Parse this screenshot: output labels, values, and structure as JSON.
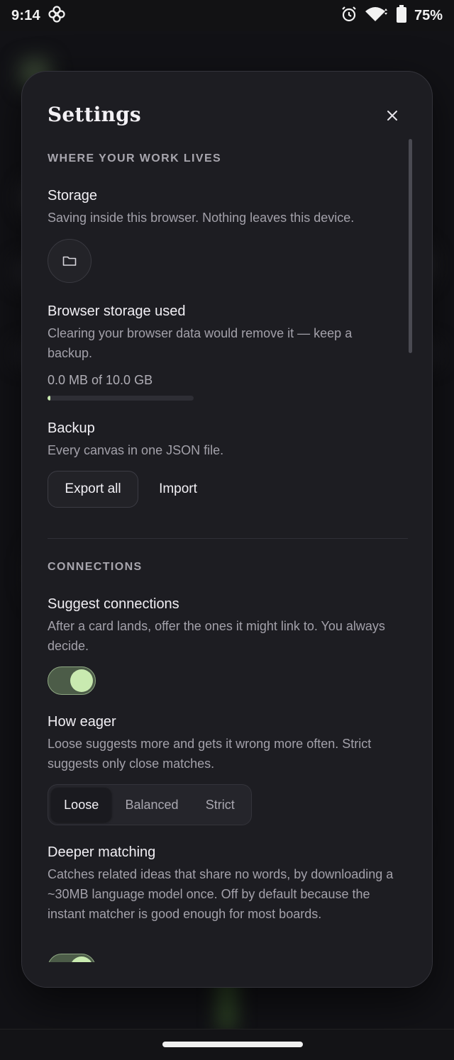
{
  "status_bar": {
    "time": "9:14",
    "battery_pct": "75%"
  },
  "modal": {
    "title": "Settings",
    "sections": {
      "work": {
        "label": "WHERE YOUR WORK LIVES",
        "storage_title": "Storage",
        "storage_desc": "Saving inside this browser. Nothing leaves this device.",
        "used_title": "Browser storage used",
        "used_desc": "Clearing your browser data would remove it — keep a backup.",
        "usage_text": "0.0 MB of 10.0 GB",
        "usage_fraction": 0.0,
        "backup_title": "Backup",
        "backup_desc": "Every canvas in one JSON file.",
        "export_label": "Export all",
        "import_label": "Import"
      },
      "connections": {
        "label": "CONNECTIONS",
        "suggest_title": "Suggest connections",
        "suggest_desc": "After a card lands, offer the ones it might link to. You always decide.",
        "suggest_on": true,
        "eager_title": "How eager",
        "eager_desc": "Loose suggests more and gets it wrong more often. Strict suggests only close matches.",
        "eager_options": [
          "Loose",
          "Balanced",
          "Strict"
        ],
        "eager_selected": "Loose",
        "deeper_title": "Deeper matching",
        "deeper_desc": "Catches related ideas that share no words, by downloading a ~30MB language model once. Off by default because the instant matcher is good enough for most boards.",
        "deeper_on": true
      }
    }
  },
  "colors": {
    "accent": "#c9eab0",
    "modal_bg": "#1d1d22",
    "text_primary": "#f1eff4",
    "text_secondary": "#a3a1aa"
  }
}
